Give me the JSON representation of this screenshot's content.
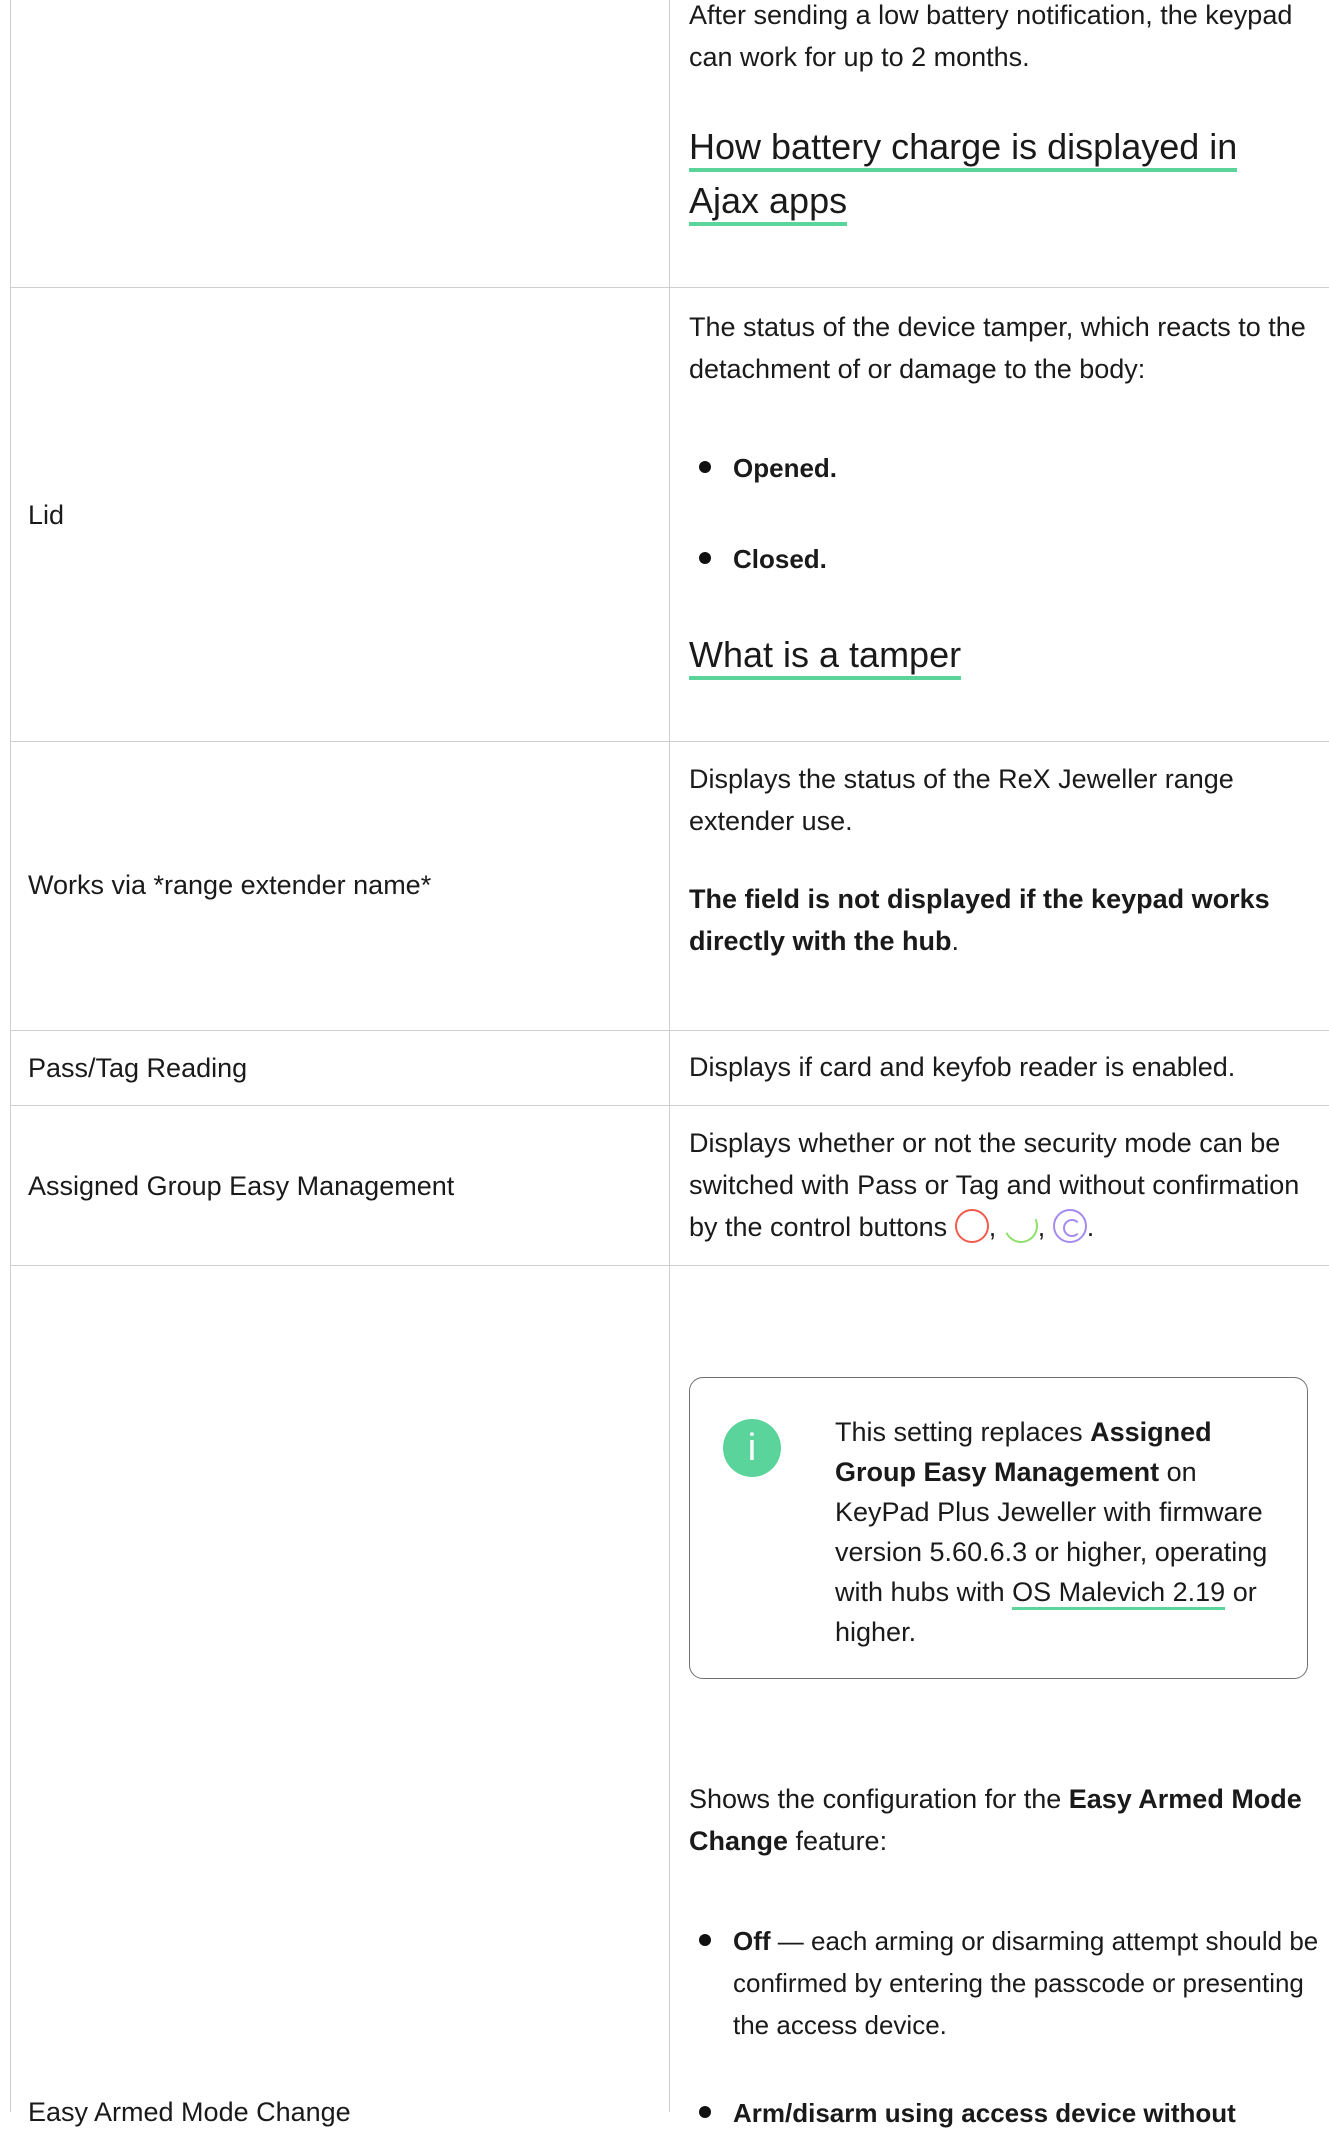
{
  "battery": {
    "text": "After sending a low battery notification, the keypad can work for up to 2 months.",
    "link_line1": "How battery charge is displayed in",
    "link_line2": "Ajax apps"
  },
  "lid": {
    "label": "Lid",
    "desc": "The status of the device tamper, which reacts to the detachment of or damage to the body:",
    "opt1": "Opened.",
    "opt2": "Closed.",
    "link": "What is a tamper"
  },
  "works_via": {
    "label": "Works via *range extender name*",
    "desc": "Displays the status of the ReX Jeweller range extender use.",
    "note_bold": "The field is not displayed if the keypad works directly with the hub",
    "note_end": "."
  },
  "pass_tag": {
    "label": "Pass/Tag Reading",
    "desc": "Displays if card and keyfob reader is enabled."
  },
  "assigned_group": {
    "label": "Assigned Group Easy Management",
    "desc": "Displays whether or not the security mode can be switched with Pass or Tag and without confirmation by the control buttons",
    "sep1": ",",
    "sep2": ",",
    "end": ".",
    "icons": [
      "arm-button-icon",
      "night-mode-button-icon",
      "disarm-button-icon"
    ],
    "icon_colors": [
      "#f05a4a",
      "#8ee06a",
      "#a58af0"
    ]
  },
  "easy_armed": {
    "label": "Easy Armed Mode Change",
    "info_icon": "info-icon",
    "note_t1": "This setting replaces ",
    "note_b1": "Assigned Group Easy Management",
    "note_t2": " on KeyPad Plus Jeweller with firmware version 5.60.6.3 or higher, operating with hubs with ",
    "note_link": "OS Malevich 2.19",
    "note_t3": " or higher.",
    "intro_t1": "Shows the configuration for the ",
    "intro_b": "Easy Armed Mode Change",
    "intro_t2": " feature:",
    "off_b": "Off",
    "off_t": " — each arming or disarming attempt should be confirmed by entering the passcode or presenting the access device.",
    "partial_b": "Arm/disarm using access device without"
  },
  "colors": {
    "accent": "#5ad49a",
    "border": "#cfcfcf"
  }
}
